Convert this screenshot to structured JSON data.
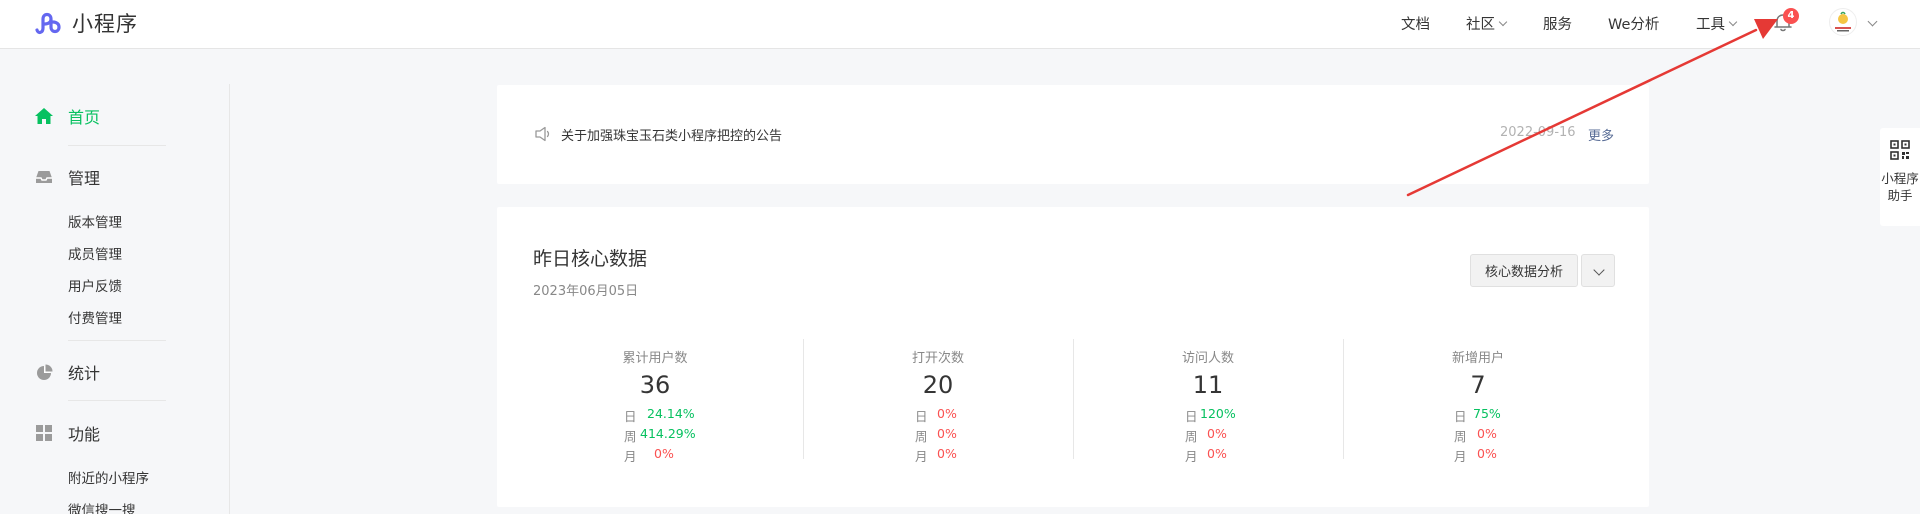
{
  "header": {
    "brand": "小程序",
    "nav": [
      {
        "label": "文档",
        "has_dropdown": false
      },
      {
        "label": "社区",
        "has_dropdown": true
      },
      {
        "label": "服务",
        "has_dropdown": false
      },
      {
        "label": "We分析",
        "has_dropdown": false
      },
      {
        "label": "工具",
        "has_dropdown": true
      }
    ],
    "notification_count": "4",
    "bell_icon": "bell-icon",
    "avatar_icon": "avatar-icon"
  },
  "sidebar": {
    "home": "首页",
    "manage": "管理",
    "manage_items": [
      "版本管理",
      "成员管理",
      "用户反馈",
      "付费管理"
    ],
    "stats": "统计",
    "features": "功能",
    "feature_items": [
      "附近的小程序",
      "微信搜一搜"
    ]
  },
  "notice": {
    "text": "关于加强珠宝玉石类小程序把控的公告",
    "date": "2022-09-16",
    "more": "更多"
  },
  "core": {
    "title": "昨日核心数据",
    "date": "2023年06月05日",
    "analysis_button": "核心数据分析",
    "metrics": [
      {
        "label": "累计用户数",
        "value": "36",
        "day": "24.14%",
        "week": "414.29%",
        "month": "0%",
        "day_trend": "up",
        "week_trend": "up",
        "month_trend": "down"
      },
      {
        "label": "打开次数",
        "value": "20",
        "day": "0%",
        "week": "0%",
        "month": "0%",
        "day_trend": "down",
        "week_trend": "down",
        "month_trend": "down"
      },
      {
        "label": "访问人数",
        "value": "11",
        "day": "120%",
        "week": "0%",
        "month": "0%",
        "day_trend": "up",
        "week_trend": "down",
        "month_trend": "down"
      },
      {
        "label": "新增用户",
        "value": "7",
        "day": "75%",
        "week": "0%",
        "month": "0%",
        "day_trend": "up",
        "week_trend": "down",
        "month_trend": "down"
      }
    ],
    "period_labels": {
      "day": "日",
      "week": "周",
      "month": "月"
    }
  },
  "helper": {
    "line1": "小程序",
    "line2": "助手"
  },
  "colors": {
    "accent": "#07c160",
    "negative": "#fa5151",
    "link": "#576b95",
    "annotation_arrow": "#e53935"
  }
}
